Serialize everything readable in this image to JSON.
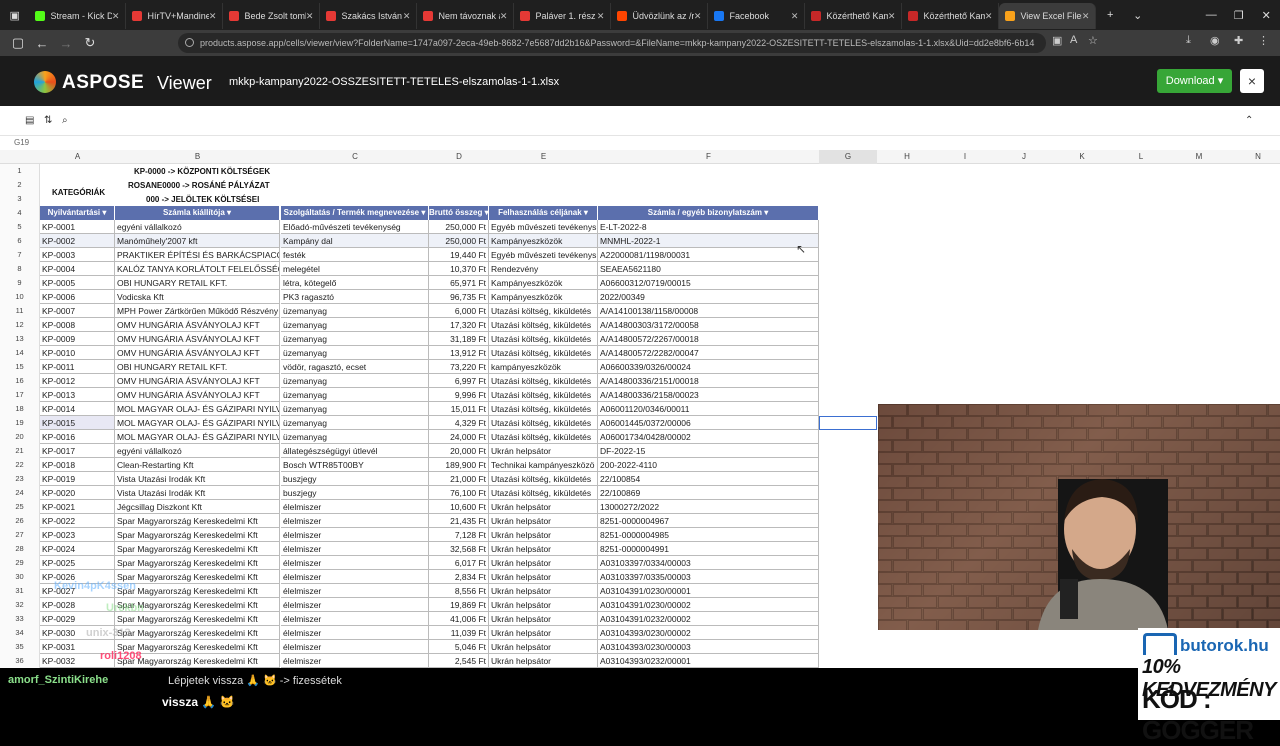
{
  "browser": {
    "tabs": [
      {
        "label": "Stream - Kick Da",
        "color": "#53fc18"
      },
      {
        "label": "HírTV+Mandine",
        "color": "#e53935"
      },
      {
        "label": "Bede Zsolt tomb",
        "color": "#e53935"
      },
      {
        "label": "Szakács István ál",
        "color": "#e53935"
      },
      {
        "label": "Nem távoznak a",
        "color": "#e53935"
      },
      {
        "label": "Paláver 1. rész -",
        "color": "#e53935"
      },
      {
        "label": "Üdvözlünk az /r/",
        "color": "#ff4500"
      },
      {
        "label": "Facebook",
        "color": "#1877f2"
      },
      {
        "label": "Közérthető Kamp",
        "color": "#c62828"
      },
      {
        "label": "Közérthető Kamp",
        "color": "#c62828"
      },
      {
        "label": "View Excel Files",
        "color": "#f9a21b"
      }
    ],
    "url": "products.aspose.app/cells/viewer/view?FolderName=1747a097-2eca-49eb-8682-7e5687dd2b16&Password=&FileName=mkkp-kampany2022-OSZESITETT-TETELES-elszamolas-1-1.xlsx&Uid=dd2e8bf6-6b14"
  },
  "app": {
    "brand": "ASPOSE",
    "product": "Viewer",
    "filename": "mkkp-kampany2022-OSSZESITETT-TETELES-elszamolas-1-1.xlsx",
    "download_label": "Download",
    "close_label": "×"
  },
  "sheet": {
    "cellref": "G19",
    "columns": [
      "A",
      "B",
      "C",
      "D",
      "E",
      "F",
      "G",
      "H",
      "I",
      "J",
      "K",
      "L",
      "M",
      "N"
    ],
    "categories_label": "KATEGÓRIÁK",
    "category_lines": [
      "KP-0000 -> KÖZPONTI KÖLTSÉGEK",
      "ROSANE0000 -> ROSÁNÉ PÁLYÁZAT",
      "000 -> JELÖLTEK KÖLTSÉSEI"
    ],
    "headers": [
      "Nyilvántartási",
      "Számla kiállítója",
      "Szolgáltatás / Termék megnevezése",
      "Bruttó összeg",
      "Felhasználás céljának",
      "Számla / egyéb bizonylatszám"
    ],
    "rows": [
      [
        "KP-0001",
        "egyéni vállalkozó",
        "Előadó-művészeti tevékenység",
        "250,000 Ft",
        "Egyéb művészeti tevékenys",
        "E-LT-2022-8"
      ],
      [
        "KP-0002",
        "Manóműhely'2007 kft",
        "Kampány dal",
        "250,000 Ft",
        "Kampányeszközök",
        "MNMHL-2022-1"
      ],
      [
        "KP-0003",
        "PRAKTIKER ÉPÍTÉSI ÉS BARKÁCSPIACOK M",
        "festék",
        "19,440 Ft",
        "Egyéb művészeti tevékenys",
        "A22000081/1198/00031"
      ],
      [
        "KP-0004",
        "KALÓZ TANYA KORLÁTOLT FELELŐSSÉGŰ TÁ",
        "melegétel",
        "10,370 Ft",
        "Rendezvény",
        "SEAEA5621180"
      ],
      [
        "KP-0005",
        "OBI HUNGARY RETAIL KFT.",
        "létra, kötegelő",
        "65,971 Ft",
        "Kampányeszközök",
        "A06600312/0719/00015"
      ],
      [
        "KP-0006",
        "Vodicska Kft",
        "PK3 ragasztó",
        "96,735 Ft",
        "Kampányeszközök",
        "2022/00349"
      ],
      [
        "KP-0007",
        "MPH Power Zártkörűen Működő Részvény",
        "üzemanyag",
        "6,000 Ft",
        "Utazási költség, kiküldetés",
        "A/A14100138/1158/00008"
      ],
      [
        "KP-0008",
        "OMV HUNGÁRIA ÁSVÁNYOLAJ KFT",
        "üzemanyag",
        "17,320 Ft",
        "Utazási költség, kiküldetés",
        "A/A14800303/3172/00058"
      ],
      [
        "KP-0009",
        "OMV HUNGÁRIA ÁSVÁNYOLAJ KFT",
        "üzemanyag",
        "31,189 Ft",
        "Utazási költség, kiküldetés",
        "A/A14800572/2267/00018"
      ],
      [
        "KP-0010",
        "OMV HUNGÁRIA ÁSVÁNYOLAJ KFT",
        "üzemanyag",
        "13,912 Ft",
        "Utazási költség, kiküldetés",
        "A/A14800572/2282/00047"
      ],
      [
        "KP-0011",
        "OBI HUNGARY RETAIL KFT.",
        "vödör, ragasztó, ecset",
        "73,220 Ft",
        "kampányeszközök",
        "A06600339/0326/00024"
      ],
      [
        "KP-0012",
        "OMV HUNGÁRIA ÁSVÁNYOLAJ KFT",
        "üzemanyag",
        "6,997 Ft",
        "Utazási költség, kiküldetés",
        "A/A14800336/2151/00018"
      ],
      [
        "KP-0013",
        "OMV HUNGÁRIA ÁSVÁNYOLAJ KFT",
        "üzemanyag",
        "9,996 Ft",
        "Utazási költség, kiküldetés",
        "A/A14800336/2158/00023"
      ],
      [
        "KP-0014",
        "MOL MAGYAR OLAJ- ÉS GÁZIPARI NYILVÁN",
        "üzemanyag",
        "15,011 Ft",
        "Utazási költség, kiküldetés",
        "A06001120/0346/00011"
      ],
      [
        "KP-0015",
        "MOL MAGYAR OLAJ- ÉS GÁZIPARI NYILVÁN",
        "üzemanyag",
        "4,329 Ft",
        "Utazási költség, kiküldetés",
        "A06001445/0372/00006"
      ],
      [
        "KP-0016",
        "MOL MAGYAR OLAJ- ÉS GÁZIPARI NYILVÁN",
        "üzemanyag",
        "24,000 Ft",
        "Utazási költség, kiküldetés",
        "A06001734/0428/00002"
      ],
      [
        "KP-0017",
        "egyéni vállalkozó",
        "állategészségügyi útlevél",
        "20,000 Ft",
        "Ukrán helpsátor",
        "DF-2022-15"
      ],
      [
        "KP-0018",
        "Clean-Restarting Kft",
        "Bosch WTR85T00BY",
        "189,900 Ft",
        "Technikai kampányeszközö",
        "200-2022-4110"
      ],
      [
        "KP-0019",
        "Vista Utazási Irodák Kft",
        "buszjegy",
        "21,000 Ft",
        "Utazási költség, kiküldetés",
        "22/100854"
      ],
      [
        "KP-0020",
        "Vista Utazási Irodák Kft",
        "buszjegy",
        "76,100 Ft",
        "Utazási költség, kiküldetés",
        "22/100869"
      ],
      [
        "KP-0021",
        "Jégcsillag Diszkont Kft",
        "élelmiszer",
        "10,600 Ft",
        "Ukrán helpsátor",
        "13000272/2022"
      ],
      [
        "KP-0022",
        "Spar Magyarország Kereskedelmi Kft",
        "élelmiszer",
        "21,435 Ft",
        "Ukrán helpsátor",
        "8251-0000004967"
      ],
      [
        "KP-0023",
        "Spar Magyarország Kereskedelmi Kft",
        "élelmiszer",
        "7,128 Ft",
        "Ukrán helpsátor",
        "8251-0000004985"
      ],
      [
        "KP-0024",
        "Spar Magyarország Kereskedelmi Kft",
        "élelmiszer",
        "32,568 Ft",
        "Ukrán helpsátor",
        "8251-0000004991"
      ],
      [
        "KP-0025",
        "Spar Magyarország Kereskedelmi Kft",
        "élelmiszer",
        "6,017 Ft",
        "Ukrán helpsátor",
        "A03103397/0334/00003"
      ],
      [
        "KP-0026",
        "Spar Magyarország Kereskedelmi Kft",
        "élelmiszer",
        "2,834 Ft",
        "Ukrán helpsátor",
        "A03103397/0335/00003"
      ],
      [
        "KP-0027",
        "Spar Magyarország Kereskedelmi Kft",
        "élelmiszer",
        "8,556 Ft",
        "Ukrán helpsátor",
        "A03104391/0230/00001"
      ],
      [
        "KP-0028",
        "Spar Magyarország Kereskedelmi Kft",
        "élelmiszer",
        "19,869 Ft",
        "Ukrán helpsátor",
        "A03104391/0230/00002"
      ],
      [
        "KP-0029",
        "Spar Magyarország Kereskedelmi Kft",
        "élelmiszer",
        "41,006 Ft",
        "Ukrán helpsátor",
        "A03104391/0232/00002"
      ],
      [
        "KP-0030",
        "Spar Magyarország Kereskedelmi Kft",
        "élelmiszer",
        "11,039 Ft",
        "Ukrán helpsátor",
        "A03104393/0230/00002"
      ],
      [
        "KP-0031",
        "Spar Magyarország Kereskedelmi Kft",
        "élelmiszer",
        "5,046 Ft",
        "Ukrán helpsátor",
        "A03104393/0230/00003"
      ],
      [
        "KP-0032",
        "Spar Magyarország Kereskedelmi Kft",
        "élelmiszer",
        "2,545 Ft",
        "Ukrán helpsátor",
        "A03104393/0232/00001"
      ]
    ]
  },
  "stream": {
    "chat_user": "amorf_SzintiKirehe",
    "chat_text": "Lépjetek vissza 🙏 🐱 -> fizessétek",
    "chat_line2": "vissza 🙏 🐱",
    "overlay_names": [
      "Kevin4pK4ssen",
      "Urekbn",
      "unix-313",
      "roli1208"
    ]
  },
  "ad": {
    "site": "butorok.hu",
    "discount": "10% KEDVEZMÉNY",
    "code": "KÓD : GOGGER"
  }
}
